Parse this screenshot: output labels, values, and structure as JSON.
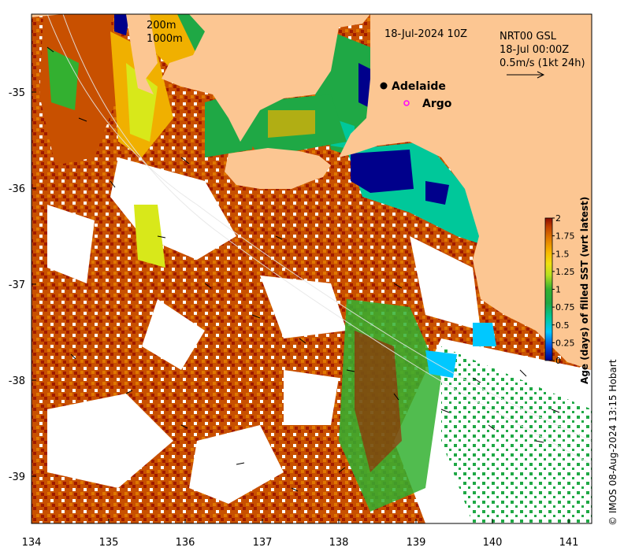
{
  "map": {
    "timestamp": "18-Jul-2024 10Z",
    "product_line1": "NRT00 GSL",
    "product_line2": "18-Jul 00:00Z",
    "scale_label": "0.5m/s (1kt 24h)",
    "contour_200": "200m",
    "contour_1000": "1000m",
    "place_adelaide": "Adelaide",
    "place_argo": "Argo",
    "credit": "© IMOS 08-Aug-2024 13:15 Hobart",
    "x_ticks": [
      "134",
      "135",
      "136",
      "137",
      "138",
      "139",
      "140",
      "141"
    ],
    "y_ticks": [
      "-35",
      "-36",
      "-37",
      "-38",
      "-39"
    ],
    "land_color": "#fcc692",
    "no_data_color": "#ffffff"
  },
  "colorbar": {
    "label": "Age (days) of filled SST (wrt latest)",
    "ticks": [
      "2",
      "1.75",
      "1.5",
      "1.25",
      "1",
      "0.75",
      "0.5",
      "0.25",
      "0"
    ],
    "range": [
      0,
      2
    ],
    "colors": [
      "#00008b",
      "#0050e0",
      "#00c8ff",
      "#00c89a",
      "#1fa845",
      "#7fd32a",
      "#d8e81a",
      "#f8c000",
      "#f08a00",
      "#d05a00",
      "#a01a00"
    ]
  }
}
